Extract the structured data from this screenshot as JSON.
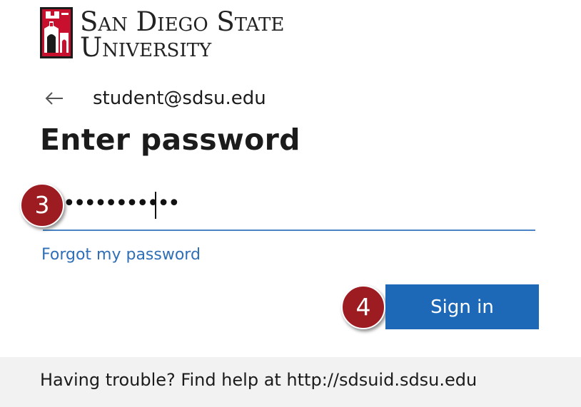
{
  "brand": {
    "line1": "San Diego State",
    "line2": "University",
    "colors": {
      "red": "#c8102e",
      "black": "#1b1b1b"
    }
  },
  "back": {
    "icon": "back-arrow-icon"
  },
  "account": {
    "email": "student@sdsu.edu"
  },
  "heading": "Enter password",
  "password": {
    "masked_value": "•••••••••••"
  },
  "markers": {
    "step3": "3",
    "step4": "4"
  },
  "forgot_link": "Forgot my password",
  "signin_label": "Sign in",
  "help": {
    "text": "Having trouble? Find help at http://sdsuid.sdsu.edu"
  },
  "colors": {
    "accent": "#1e68b8",
    "link": "#2f6fb8",
    "marker": "#9c1c22",
    "footer_bg": "#f2f2f2"
  }
}
